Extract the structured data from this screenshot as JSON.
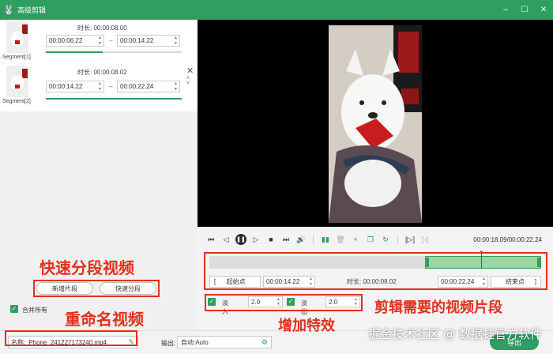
{
  "window": {
    "title": "高级剪辑",
    "controls": [
      "–",
      "☐",
      "✕"
    ]
  },
  "segments": [
    {
      "label": "Segment[1]",
      "duration_text": "时长: 00:00:08.00",
      "start": "00:00:06.22",
      "end": "00:00:14.22",
      "progress": 0.42
    },
    {
      "label": "Segment[2]",
      "duration_text": "时长: 00:00:08.02",
      "start": "00:00:14.22",
      "end": "00:00:22.24",
      "progress": 1.0
    }
  ],
  "player": {
    "timecode": "00:00:18.09/00:00:22.24"
  },
  "timeline": {
    "selection_start": 0.65,
    "selection_end": 1.0,
    "playhead": 0.82
  },
  "trim": {
    "start_button": "起始点",
    "start_value": "00:00:14.22",
    "duration_text": "时长: 00:00:08.02",
    "end_value": "00:00:22.24",
    "end_button": "结束点"
  },
  "effects": {
    "fade_in_label": "淡入",
    "fade_in_value": "2.0",
    "fade_out_label": "淡出",
    "fade_out_value": "2.0"
  },
  "left_actions": {
    "add_segment": "新增片段",
    "quick_split": "快速分段",
    "merge_all": "合并所有"
  },
  "bottom": {
    "name_label": "名称:",
    "name_value": "Phone_241227173240.mp4",
    "output_label": "输出:",
    "output_value": "自动:Auto",
    "export_label": "导出"
  },
  "annotations": {
    "quick_split": "快速分段视频",
    "rename": "重命名视频",
    "effects": "增加特效",
    "clip": "剪辑需要的视频片段"
  },
  "watermark": "掘金技术社区 @ 数据蛙官方软件",
  "colors": {
    "accent": "#2f9e61",
    "annotation": "#e0301e"
  }
}
